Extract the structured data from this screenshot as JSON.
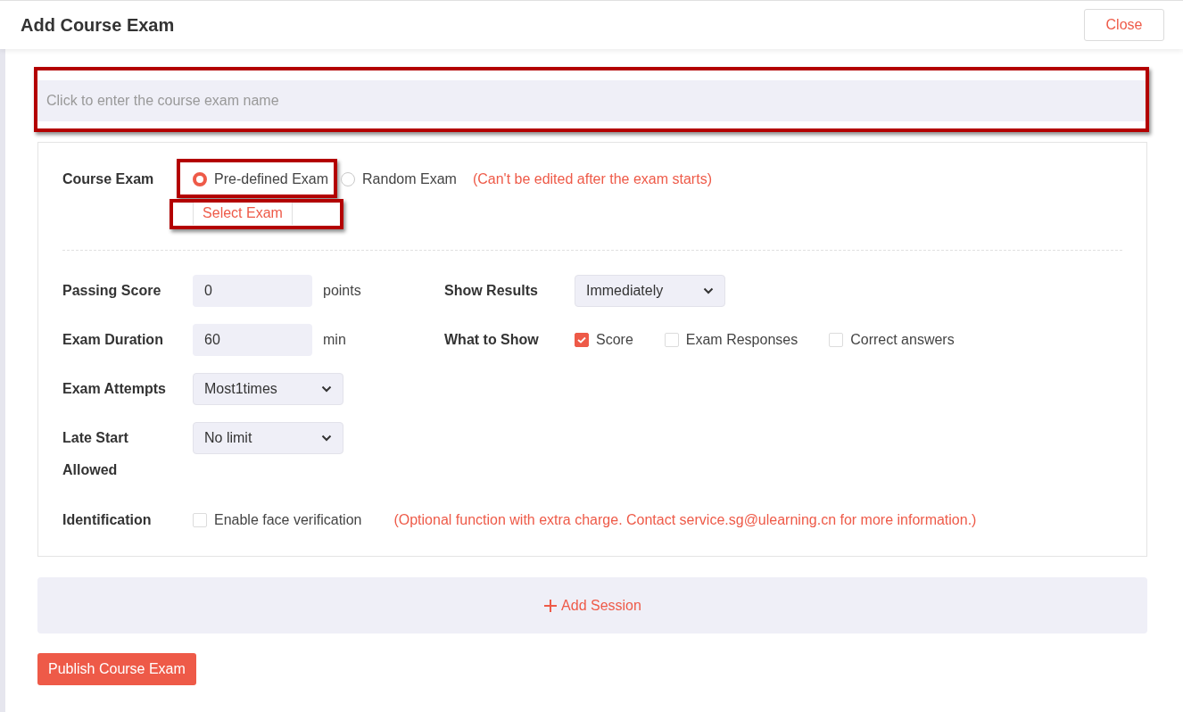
{
  "title": "Add Course Exam",
  "close_button": "Close",
  "name_field": {
    "placeholder": "Click to enter the course exam name"
  },
  "course_exam": {
    "label": "Course Exam",
    "options": [
      {
        "label": "Pre-defined Exam",
        "selected": true
      },
      {
        "label": "Random Exam",
        "selected": false
      }
    ],
    "note": "(Can't be edited after the exam starts)",
    "select_button": "Select Exam"
  },
  "settings_left": [
    {
      "kind": "input",
      "label": "Passing Score",
      "value": "0",
      "unit": "points"
    },
    {
      "kind": "input",
      "label": "Exam Duration",
      "value": "60",
      "unit": "min"
    },
    {
      "kind": "select",
      "label": "Exam Attempts",
      "value": "Most1times"
    },
    {
      "kind": "select",
      "label": "Late Start Allowed",
      "value": "No limit"
    }
  ],
  "settings_right": [
    {
      "kind": "select",
      "label": "Show Results",
      "value": "Immediately"
    },
    {
      "kind": "checkboxes",
      "label": "What to Show",
      "options": [
        {
          "label": "Score",
          "checked": true
        },
        {
          "label": "Exam Responses",
          "checked": false
        },
        {
          "label": "Correct answers",
          "checked": false
        }
      ]
    }
  ],
  "identification": {
    "label": "Identification",
    "checkbox": {
      "label": "Enable face verification",
      "checked": false
    },
    "note": "(Optional function with extra charge. Contact service.sg@ulearning.cn for more information.)"
  },
  "add_session": "Add Session",
  "publish_button": "Publish Course Exam"
}
